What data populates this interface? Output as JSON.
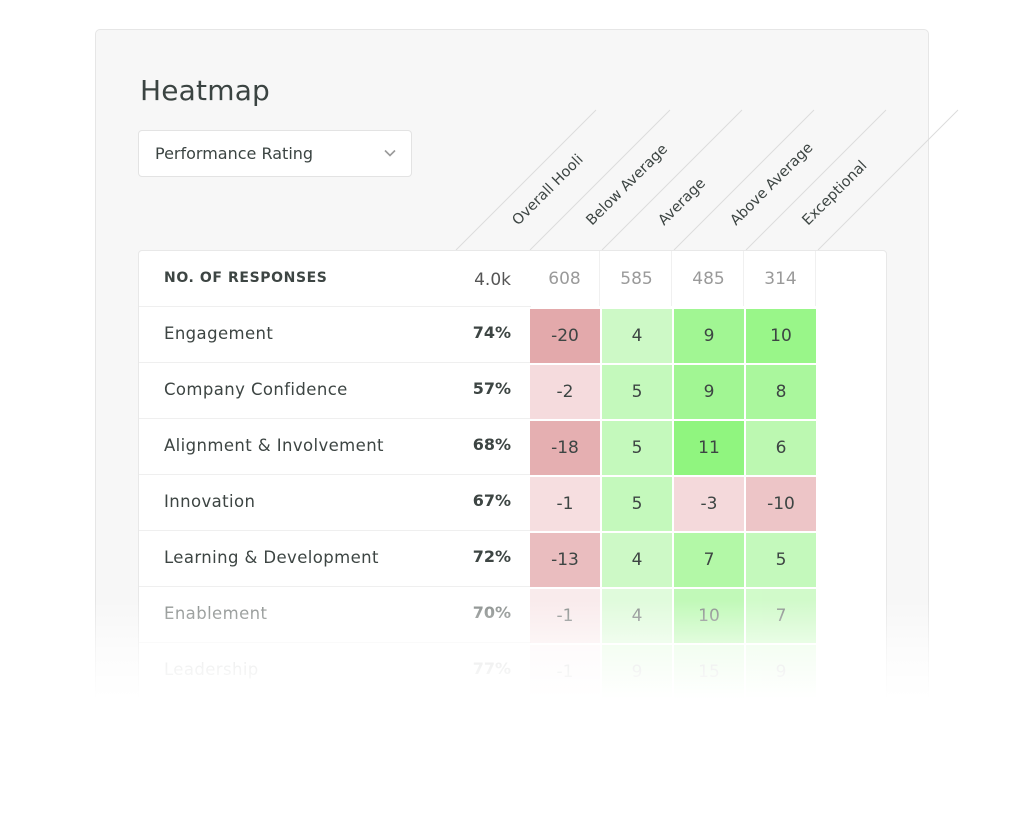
{
  "title": "Heatmap",
  "filter": {
    "selected": "Performance Rating",
    "icon": "chevron-down-icon"
  },
  "chart_data": {
    "type": "heatmap",
    "title": "Heatmap",
    "columns": [
      "Overall Hooli",
      "Below Average",
      "Average",
      "Above Average",
      "Exceptional"
    ],
    "responses_label": "NO. OF RESPONSES",
    "responses": [
      "4.0k",
      "608",
      "585",
      "485",
      "314"
    ],
    "rows": [
      {
        "label": "Engagement",
        "overall": "74%",
        "values": [
          -20,
          4,
          9,
          10
        ]
      },
      {
        "label": "Company Confidence",
        "overall": "57%",
        "values": [
          -2,
          5,
          9,
          8
        ]
      },
      {
        "label": "Alignment & Involvement",
        "overall": "68%",
        "values": [
          -18,
          5,
          11,
          6
        ]
      },
      {
        "label": "Innovation",
        "overall": "67%",
        "values": [
          -1,
          5,
          -3,
          -10
        ]
      },
      {
        "label": "Learning & Development",
        "overall": "72%",
        "values": [
          -13,
          4,
          7,
          5
        ]
      },
      {
        "label": "Enablement",
        "overall": "70%",
        "values": [
          -1,
          4,
          10,
          7
        ]
      },
      {
        "label": "Leadership",
        "overall": "77%",
        "values": [
          -1,
          9,
          15,
          9
        ]
      }
    ],
    "colors": {
      "negative": "#e3a9ab",
      "positive": "#90f57f",
      "neutral": "#ffffff"
    }
  }
}
